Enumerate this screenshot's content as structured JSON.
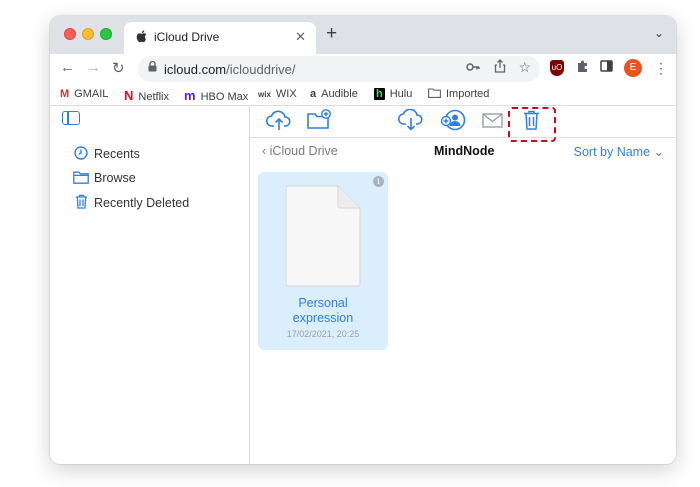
{
  "browser": {
    "tab": {
      "title": "iCloud Drive",
      "icon": "apple-logo-icon",
      "close": "✕"
    },
    "new_tab": "+",
    "tab_menu": "⌄",
    "url_host": "icloud.com",
    "url_path": "/iclouddrive/",
    "avatar_letter": "E",
    "ublock_label": "uO"
  },
  "bookmarks": [
    {
      "label": "GMAIL",
      "icon": "gmail-icon",
      "glyph": "M",
      "color": "#d93025"
    },
    {
      "label": "Netflix",
      "icon": "netflix-icon",
      "glyph": "N",
      "color": "#e50914"
    },
    {
      "label": "HBO Max",
      "icon": "hbo-max-icon",
      "glyph": "m",
      "color": "#5b1bd6"
    },
    {
      "label": "WIX",
      "icon": "wix-icon",
      "glyph": "wix",
      "color": "#000000"
    },
    {
      "label": "Audible",
      "icon": "amazon-icon",
      "glyph": "a",
      "color": "#000000"
    },
    {
      "label": "Hulu",
      "icon": "hulu-icon",
      "glyph": "h",
      "color": "#1ce783"
    },
    {
      "label": "Imported",
      "icon": "folder-icon",
      "glyph": "🗀",
      "color": "#5f6368"
    }
  ],
  "sidebar": {
    "items": [
      {
        "label": "Recents",
        "icon": "clock-icon"
      },
      {
        "label": "Browse",
        "icon": "folder-icon"
      },
      {
        "label": "Recently Deleted",
        "icon": "trash-icon"
      }
    ]
  },
  "toolbar": {
    "icons": [
      "upload-icon",
      "new-folder-icon",
      "download-icon",
      "share-user-icon",
      "mail-icon",
      "trash-icon"
    ],
    "highlight_color": "#d9001b"
  },
  "header": {
    "back_label": "iCloud Drive",
    "folder_title": "MindNode",
    "sort_label": "Sort by Name"
  },
  "files": [
    {
      "name_line1": "Personal",
      "name_line2": "expression",
      "date": "17/02/2021, 20:25"
    }
  ],
  "colors": {
    "accent": "#2f7ee6",
    "selection": "#dbeefc"
  }
}
